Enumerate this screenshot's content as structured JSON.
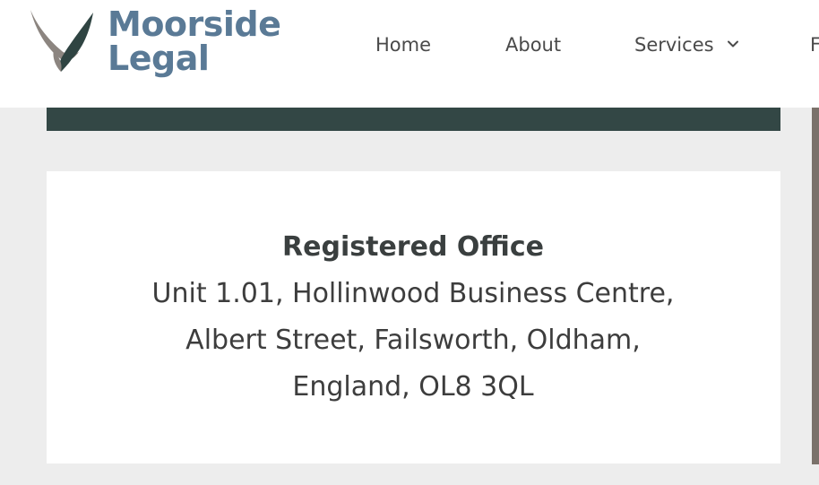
{
  "brand": {
    "line1": "Moorside",
    "line2": "Legal",
    "color": "#5a7a96",
    "mark_colors": [
      "#8c8580",
      "#2f4442"
    ]
  },
  "nav": {
    "items": [
      {
        "label": "Home"
      },
      {
        "label": "About"
      },
      {
        "label": "Services"
      },
      {
        "label": "F"
      }
    ]
  },
  "office": {
    "title": "Registered Office",
    "address_lines": [
      "Unit 1.01, Hollinwood Business Centre,",
      "Albert Street, Failsworth, Oldham,",
      "England, OL8 3QL"
    ]
  },
  "colors": {
    "dark_bar": "#334745",
    "page_bg": "#ededed",
    "card_bg": "#ffffff",
    "accent_strip": "#7a716a"
  }
}
